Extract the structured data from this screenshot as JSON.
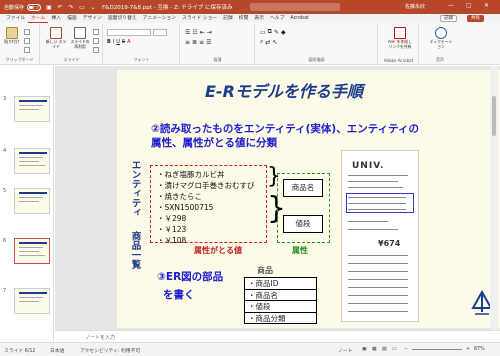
{
  "titlebar": {
    "autosave_label": "自動保存",
    "autosave_state": "オフ",
    "doc_title": "F&D2019-7&8.ppt  -  互換  -  Z: ドライブ に保存済み",
    "user": "佐藤永欣"
  },
  "tabs": [
    "ファイル",
    "ホーム",
    "挿入",
    "描画",
    "デザイン",
    "画面切り替え",
    "アニメーション",
    "スライド ショー",
    "記録",
    "校閲",
    "表示",
    "ヘルプ",
    "Acrobat"
  ],
  "tabs_right": {
    "record": "記録",
    "share": "共有"
  },
  "ribbon": {
    "groups": [
      "クリップボード",
      "スライド",
      "フォント",
      "段落",
      "図形描画",
      "Adobe Acrobat",
      "音声"
    ],
    "paste_label": "貼り付け",
    "new_slide_label": "新しい スライド",
    "reuse_label": "スライドの 再利用",
    "pdf_label": "PDF を作成し リンクを共有",
    "dictate_label": "ディクテーション"
  },
  "slides": {
    "numbers": [
      "3",
      "4",
      "5",
      "6",
      "7"
    ]
  },
  "slide": {
    "title": "E-Rモデルを作る手順",
    "subtitle": "②読み取ったものをエンティティ(実体)、エンティティの属性、属性がとる値に分類",
    "vertical_top": "エンティティ",
    "vertical_bottom": "商品一覧",
    "items": [
      "・ねぎ塩豚カルビ丼",
      "・漬けマグロ手巻きおむすび",
      "・焼きたらこ",
      "・SXN1500715",
      "・￥298",
      "・￥123",
      "・￥108"
    ],
    "field_name": "商品名",
    "field_price": "値段",
    "label_values": "属性がとる値",
    "label_attribute": "属性",
    "receipt_logo": "UNIV.",
    "receipt_total": "¥674",
    "section3": [
      "③ER図の部品",
      "を書く"
    ],
    "entity_name": "商品",
    "entity_rows": [
      "・商品ID",
      "・商品名",
      "・値段",
      "・商品分類"
    ]
  },
  "notes_placeholder": "ノートを入力",
  "status": {
    "slide_info": "スライド 6/12",
    "language": "日本語",
    "accessibility": "アクセシビリティ: 利用不可",
    "notes": "ノート",
    "zoom": "87%"
  },
  "colors": {
    "accent": "#b7472a",
    "title_blue": "#1c3c8c",
    "subtitle_blue": "#1c1ccc",
    "red": "#d02020",
    "green": "#2a9a2a"
  }
}
